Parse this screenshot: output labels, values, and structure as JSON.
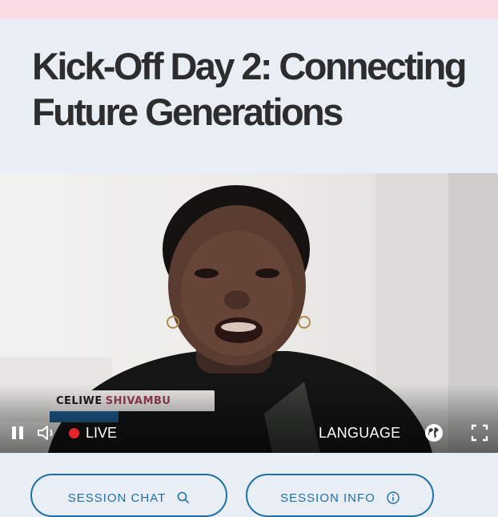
{
  "session": {
    "title_line1": "Kick-Off Day 2: Connecting",
    "title_line2": "Future Generations"
  },
  "player": {
    "speaker_first": "CELIWE",
    "speaker_last": "SHIVAMBU",
    "live_label": "LIVE",
    "language_label": "LANGUAGE",
    "icons": {
      "pause": "pause-icon",
      "volume": "volume-icon",
      "globe": "globe-icon",
      "fullscreen": "fullscreen-icon"
    },
    "colors": {
      "live_dot": "#e0262b",
      "name_accent": "#1f5f93",
      "last_name": "#9a3d52"
    }
  },
  "tabs": {
    "chat_label": "SESSION CHAT",
    "chat_icon": "search-icon",
    "info_label": "SESSION INFO",
    "info_icon": "info-icon"
  },
  "colors": {
    "accent": "#1f6fa8",
    "top_bar": "#f7dbe0",
    "page_bg": "#e8eef3"
  }
}
